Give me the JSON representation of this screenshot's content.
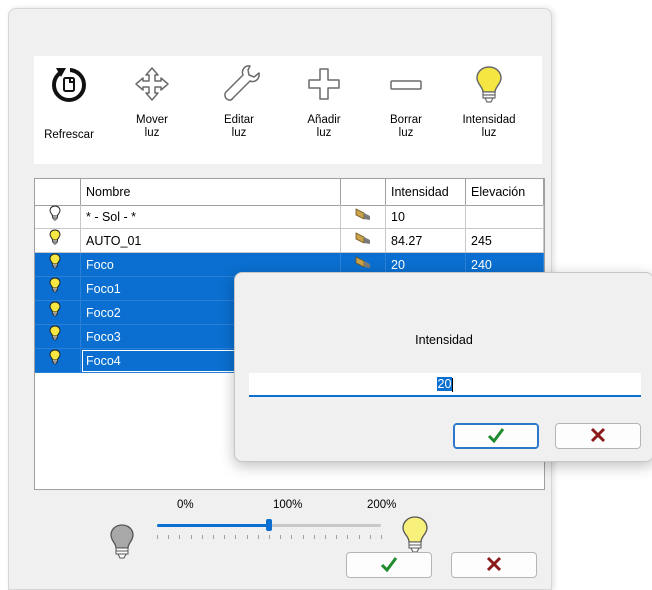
{
  "toolbar": {
    "buttons": [
      {
        "id": "refresh",
        "label": "Refrescar",
        "icon": "refresh-icon"
      },
      {
        "id": "move",
        "label": "Mover\nluz",
        "icon": "move-icon"
      },
      {
        "id": "edit",
        "label": "Editar\nluz",
        "icon": "wrench-icon"
      },
      {
        "id": "add",
        "label": "Añadir\nluz",
        "icon": "plus-icon"
      },
      {
        "id": "delete",
        "label": "Borrar\nluz",
        "icon": "minus-icon"
      },
      {
        "id": "intensity",
        "label": "Intensidad\nluz",
        "icon": "bulb-icon"
      }
    ]
  },
  "grid": {
    "columns": [
      "",
      "Nombre",
      "",
      "Intensidad",
      "Elevación"
    ],
    "rows": [
      {
        "icon": "bulb-off-icon",
        "name": "* - Sol - *",
        "intensity": "10",
        "elevation": "",
        "selected": false
      },
      {
        "icon": "bulb-on-icon",
        "name": "AUTO_01",
        "intensity": "84.27",
        "elevation": "245",
        "selected": false
      },
      {
        "icon": "bulb-on-icon",
        "name": "Foco",
        "intensity": "20",
        "elevation": "240",
        "selected": true
      },
      {
        "icon": "bulb-on-icon",
        "name": "Foco1",
        "intensity": "",
        "elevation": "",
        "selected": true
      },
      {
        "icon": "bulb-on-icon",
        "name": "Foco2",
        "intensity": "",
        "elevation": "",
        "selected": true
      },
      {
        "icon": "bulb-on-icon",
        "name": "Foco3",
        "intensity": "",
        "elevation": "",
        "selected": true
      },
      {
        "icon": "bulb-on-icon",
        "name": "Foco4",
        "intensity": "",
        "elevation": "",
        "selected": true
      }
    ]
  },
  "slider": {
    "labels": {
      "min": "0%",
      "mid": "100%",
      "max": "200%"
    },
    "value_percent": 100,
    "min_percent": 0,
    "max_percent": 200
  },
  "footer": {
    "ok_icon": "check-icon",
    "cancel_icon": "x-icon"
  },
  "dialog": {
    "label": "Intensidad",
    "value": "20",
    "ok_icon": "check-icon",
    "cancel_icon": "x-icon"
  },
  "colors": {
    "accent": "#0a6fd0",
    "check": "#1e8c2e",
    "cancel": "#8b1a1a",
    "bulb": "#f5e642"
  }
}
